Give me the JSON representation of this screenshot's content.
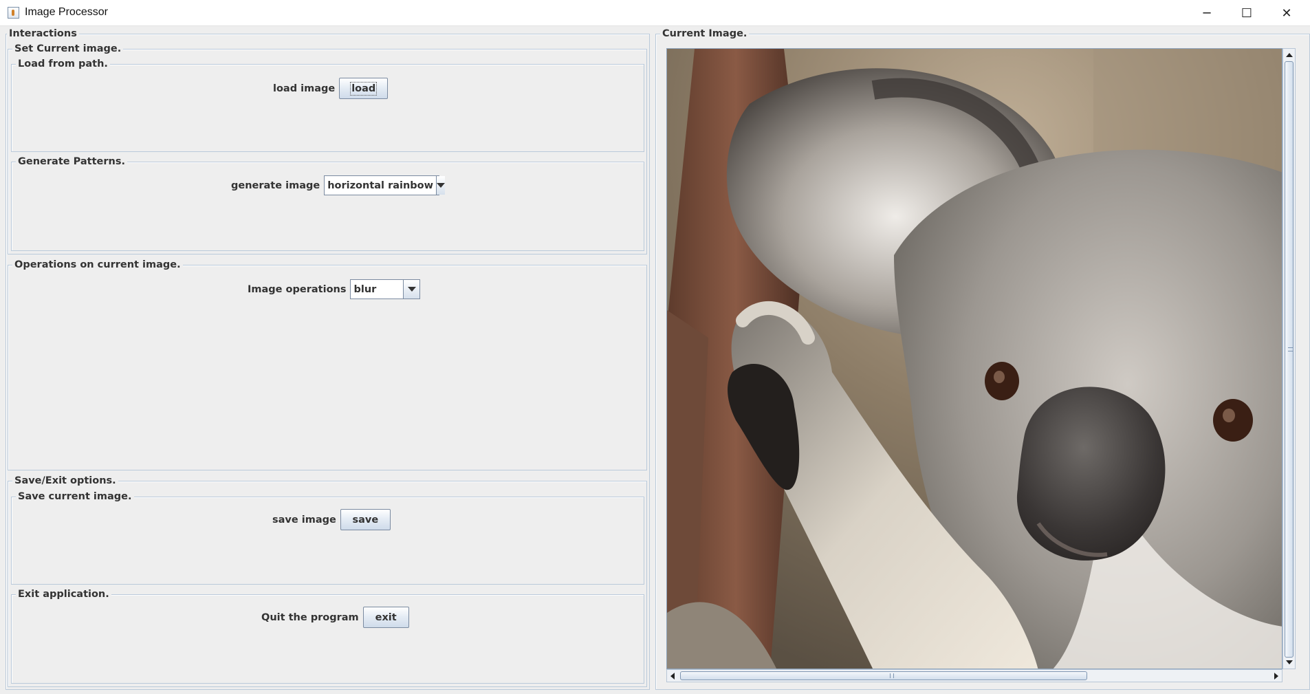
{
  "window": {
    "title": "Image Processor",
    "controls": {
      "minimize": "─",
      "maximize": "☐",
      "close": "✕"
    }
  },
  "interactions": {
    "title": "Interactions",
    "set_current_image": {
      "title": "Set Current image.",
      "load_from_path": {
        "title": "Load from path.",
        "label": "load image",
        "button": "load"
      },
      "generate_patterns": {
        "title": "Generate Patterns.",
        "label": "generate image",
        "selected": "horizontal rainbow"
      }
    },
    "operations": {
      "title": "Operations on current image.",
      "label": "Image operations",
      "selected": "blur"
    },
    "save_exit": {
      "title": "Save/Exit options.",
      "save": {
        "title": "Save current image.",
        "label": "save image",
        "button": "save"
      },
      "exit": {
        "title": "Exit application.",
        "label": "Quit the program",
        "button": "exit"
      }
    }
  },
  "current_image": {
    "title": "Current Image.",
    "subject": "koala photograph",
    "vertical_scroll_fraction": 0,
    "horizontal_scroll_fraction": 0
  },
  "colors": {
    "panel_bg": "#eeeeee",
    "border": "#b9c9da",
    "button_gradient_end": "#cfdbea"
  }
}
